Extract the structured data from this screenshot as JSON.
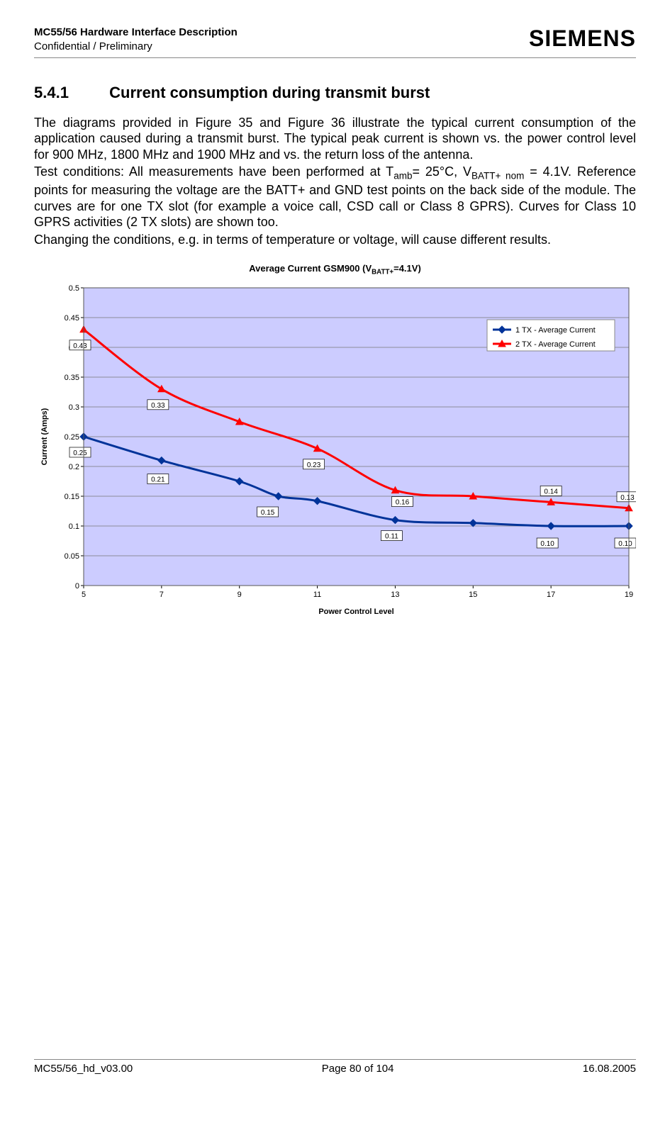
{
  "header": {
    "doc_title": "MC55/56 Hardware Interface Description",
    "confidentiality": "Confidential / Preliminary",
    "logo": "SIEMENS"
  },
  "section": {
    "number": "5.4.1",
    "title": "Current consumption during transmit burst"
  },
  "paragraphs": {
    "p1": "The diagrams provided in Figure 35 and Figure 36 illustrate the typical current consumption of the application caused during a transmit burst. The typical peak current is shown vs. the power control level for 900 MHz, 1800 MHz and 1900 MHz and vs. the return loss of the antenna.",
    "p2a": "Test conditions: All measurements have been performed at T",
    "p2a_sub": "amb",
    "p2b": "= 25°C, V",
    "p2b_sub": "BATT+ nom",
    "p2c": " = 4.1V. Reference points for measuring the voltage are the BATT+ and GND test points on the back side of the module. The curves are for one TX slot (for example a voice call, CSD call or Class 8 GPRS). Curves for Class 10 GPRS activities (2 TX slots) are shown too.",
    "p3": "Changing the conditions, e.g. in terms of temperature or voltage, will cause different results."
  },
  "chart_data": {
    "type": "line",
    "title_prefix": "Average Current GSM900 (V",
    "title_sub": "BATT+",
    "title_suffix": "=4.1V)",
    "xlabel": "Power Control Level",
    "ylabel": "Current (Amps)",
    "xlim": [
      5,
      19
    ],
    "ylim": [
      0,
      0.5
    ],
    "xticks": [
      5,
      7,
      9,
      11,
      13,
      15,
      17,
      19
    ],
    "yticks": [
      0,
      0.05,
      0.1,
      0.15,
      0.2,
      0.25,
      0.3,
      0.35,
      0.4,
      0.45,
      0.5
    ],
    "series": [
      {
        "name": "1 TX - Average Current",
        "color": "#003399",
        "marker": "diamond",
        "data": [
          {
            "x": 5,
            "y": 0.25,
            "label": "0.25"
          },
          {
            "x": 7,
            "y": 0.21,
            "label": "0.21"
          },
          {
            "x": 9,
            "y": 0.175
          },
          {
            "x": 10,
            "y": 0.15,
            "label": "0.15"
          },
          {
            "x": 11,
            "y": 0.142
          },
          {
            "x": 13,
            "y": 0.11,
            "label": "0.11"
          },
          {
            "x": 15,
            "y": 0.105
          },
          {
            "x": 17,
            "y": 0.1,
            "label": "0.10"
          },
          {
            "x": 19,
            "y": 0.1,
            "label": "0.10"
          }
        ]
      },
      {
        "name": "2 TX - Average Current",
        "color": "#ff0000",
        "marker": "triangle",
        "data": [
          {
            "x": 5,
            "y": 0.43,
            "label": "0.43"
          },
          {
            "x": 7,
            "y": 0.33,
            "label": "0.33"
          },
          {
            "x": 9,
            "y": 0.275
          },
          {
            "x": 11,
            "y": 0.23,
            "label": "0.23"
          },
          {
            "x": 13,
            "y": 0.16,
            "label": "0.16"
          },
          {
            "x": 15,
            "y": 0.15
          },
          {
            "x": 17,
            "y": 0.14,
            "label": "0.14"
          },
          {
            "x": 19,
            "y": 0.13,
            "label": "0.13"
          }
        ]
      }
    ],
    "legend": [
      "1 TX - Average Current",
      "2 TX - Average Current"
    ]
  },
  "footer": {
    "left": "MC55/56_hd_v03.00",
    "center": "Page 80 of 104",
    "right": "16.08.2005"
  }
}
